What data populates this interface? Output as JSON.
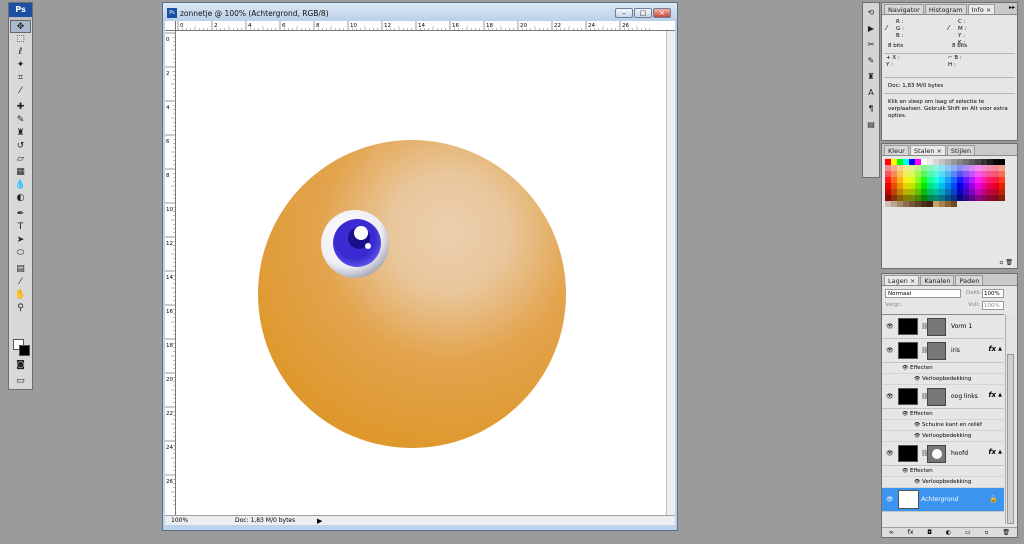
{
  "toolbox": {
    "logo": "Ps",
    "tools": [
      {
        "name": "move-tool",
        "glyph": "✥"
      },
      {
        "name": "marquee-tool",
        "glyph": "⬚"
      },
      {
        "name": "lasso-tool",
        "glyph": "ℓ"
      },
      {
        "name": "magic-wand-tool",
        "glyph": "✦"
      },
      {
        "name": "crop-tool",
        "glyph": "⌗"
      },
      {
        "name": "eyedropper-tool",
        "glyph": "⁄"
      },
      {
        "name": "healing-brush-tool",
        "glyph": "✚"
      },
      {
        "name": "brush-tool",
        "glyph": "✎"
      },
      {
        "name": "clone-stamp-tool",
        "glyph": "♜"
      },
      {
        "name": "history-brush-tool",
        "glyph": "↺"
      },
      {
        "name": "eraser-tool",
        "glyph": "▱"
      },
      {
        "name": "gradient-tool",
        "glyph": "▦"
      },
      {
        "name": "blur-tool",
        "glyph": "💧"
      },
      {
        "name": "dodge-tool",
        "glyph": "◐"
      },
      {
        "name": "pen-tool",
        "glyph": "✒"
      },
      {
        "name": "type-tool",
        "glyph": "T"
      },
      {
        "name": "path-selection-tool",
        "glyph": "➤"
      },
      {
        "name": "shape-tool",
        "glyph": "⬭"
      },
      {
        "name": "notes-tool",
        "glyph": "▤"
      },
      {
        "name": "eyedropper-tool-2",
        "glyph": "⁄"
      },
      {
        "name": "hand-tool",
        "glyph": "✋"
      },
      {
        "name": "zoom-tool",
        "glyph": "⚲"
      }
    ],
    "quickmask_glyph": "◙",
    "screenmode_glyph": "▭"
  },
  "document": {
    "title": "zonnetje @ 100% (Achtergrond, RGB/8)",
    "ps_icon": "Ps",
    "minimize": "–",
    "maximize": "□",
    "close": "×",
    "ruler_top": [
      "0",
      "2",
      "4",
      "6",
      "8",
      "10",
      "12",
      "14",
      "16",
      "18",
      "20",
      "22",
      "24",
      "26"
    ],
    "ruler_left": [
      "0",
      "2",
      "4",
      "6",
      "8",
      "10",
      "12",
      "14",
      "16",
      "18",
      "20",
      "22",
      "24",
      "26"
    ],
    "status_zoom": "100%",
    "status_doc": "Doc: 1,83 M/0 bytes",
    "status_arrow": "▶"
  },
  "info_panel": {
    "tabs": [
      "Navigator",
      "Histogram",
      "Info"
    ],
    "active_tab": "Info",
    "rgb_labels": "R :\nG :\nB :",
    "cmyk_labels": "C :\nM :\nY :\nK :",
    "bits_left": "8 bits",
    "bits_right": "8 bits",
    "xy_labels": "X :\nY :",
    "wh_labels": "B :\nH :",
    "doc_size": "Doc: 1,83 M/0 bytes",
    "help_text": "Klik en sleep om laag of selectie te verplaatsen.  Gebruik Shift en Alt voor extra opties."
  },
  "swatches_panel": {
    "tabs": [
      "Kleur",
      "Stalen",
      "Stijlen"
    ],
    "active_tab": "Stalen"
  },
  "layers_panel": {
    "tabs": [
      "Lagen",
      "Kanalen",
      "Paden"
    ],
    "active_tab": "Lagen",
    "blend_mode": "Normaal",
    "opacity_label": "Dekk:",
    "opacity_value": "100%",
    "lock_label": "Vergr.:",
    "fill_label": "Vull:",
    "fill_value": "100%",
    "layers": [
      {
        "name": "Vorm 1",
        "fx": false
      },
      {
        "name": "iris",
        "fx": true,
        "effects_label": "Effecten",
        "effects": [
          "Verloopbedekking"
        ]
      },
      {
        "name": "oog links",
        "fx": true,
        "effects_label": "Effecten",
        "effects": [
          "Schuine kant en reliëf",
          "Verloopbedekking"
        ]
      },
      {
        "name": "hoofd",
        "fx": true,
        "effects_label": "Effecten",
        "effects": [
          "Verloopbedekking"
        ]
      },
      {
        "name": "Achtergrond",
        "selected": true
      }
    ],
    "fx_symbol": "fx",
    "lock_symbol": "🔒"
  },
  "colors": {
    "selection": "#3b95f0",
    "ps_blue": "#1b4fa4",
    "ball_orange": "#e09a30",
    "iris_blue": "#3a2ad0"
  }
}
